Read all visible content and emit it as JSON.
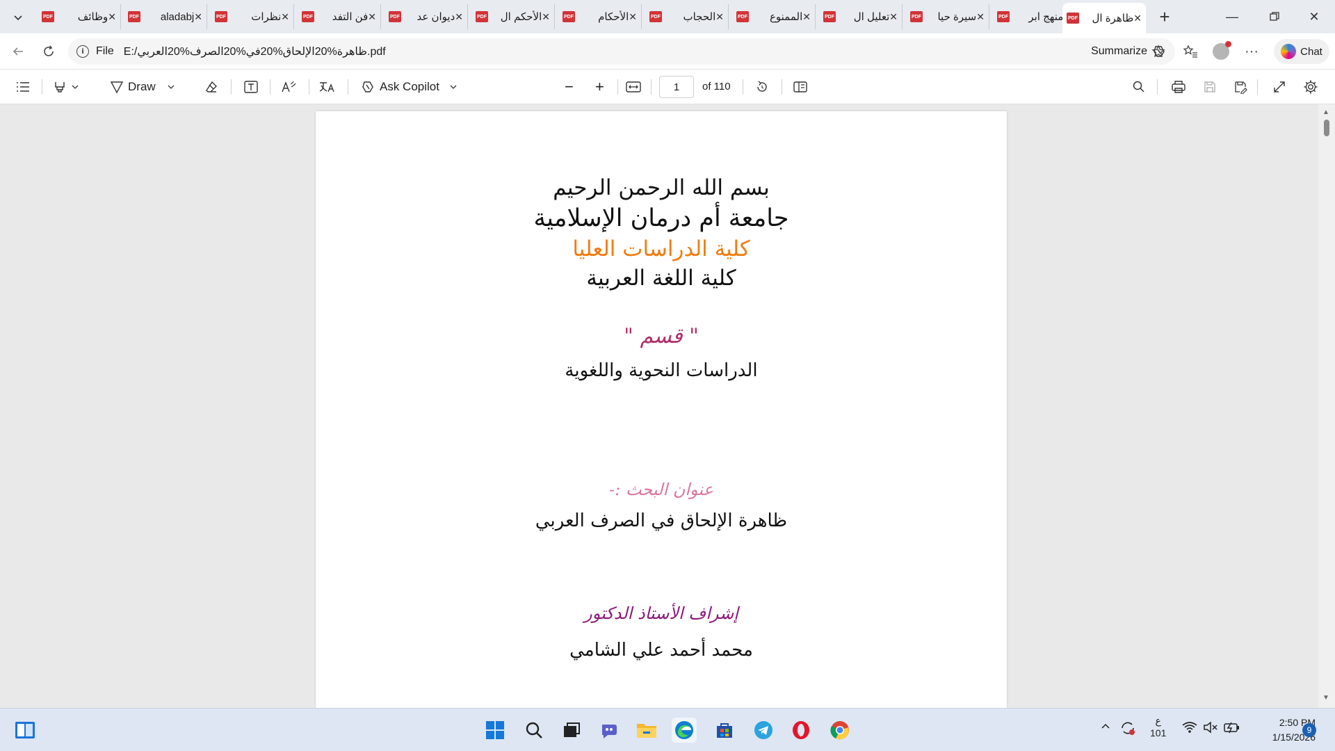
{
  "browser": {
    "tabs": [
      {
        "title": "وظائف"
      },
      {
        "title": "aladabj"
      },
      {
        "title": "نظرات"
      },
      {
        "title": "فن التفد"
      },
      {
        "title": "ديوان عد"
      },
      {
        "title": "الأحكم ال"
      },
      {
        "title": "الأحكام"
      },
      {
        "title": "الحجاب"
      },
      {
        "title": "الممنوع"
      },
      {
        "title": "تعليل ال"
      },
      {
        "title": "سيرة حيا"
      },
      {
        "title": "منهج ابر"
      },
      {
        "title": "ظاهرة ال"
      }
    ],
    "address": {
      "scheme_label": "File",
      "url": "E:/ظاهرة%20الإلحاق%20في%20الصرف%20العربي.pdf"
    },
    "summarize_label": "Summarize",
    "chat_label": "Chat"
  },
  "pdf_toolbar": {
    "draw_label": "Draw",
    "ask_copilot_label": "Ask Copilot",
    "current_page": "1",
    "page_total_label": "of 110"
  },
  "document": {
    "lines": {
      "basmala": "بسم الله الرحمن الرحيم",
      "university": "جامعة أم درمان الإسلامية",
      "college_grad": "كلية الدراسات العليا",
      "college_arabic": "كلية اللغة العربية",
      "dept_label": "\" قسم \"",
      "dept_name": "الدراسات النحوية واللغوية",
      "research_title_label": "عنوان البحث :-",
      "research_title": "ظاهرة الإلحاق في الصرف العربي",
      "supervisor_label": "إشراف الأستاذ الدكتور",
      "supervisor_name": "محمد أحمد علي الشامي"
    },
    "colors": {
      "accent_orange": "#f07c10",
      "accent_magenta": "#b0306a",
      "accent_purple": "#8a1a7a"
    }
  },
  "taskbar": {
    "tray_lang": "ع",
    "tray_count": "101",
    "time": "2:50 PM",
    "date": "1/15/2026",
    "notifications": "9"
  }
}
